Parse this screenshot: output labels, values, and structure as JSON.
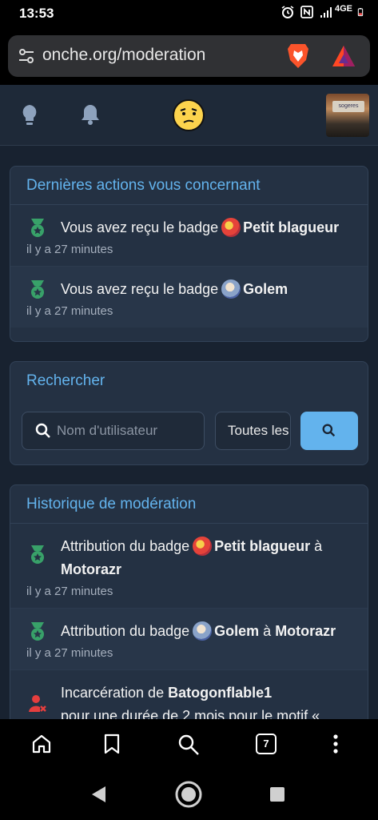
{
  "status": {
    "time": "13:53",
    "network": "4GE"
  },
  "browser": {
    "url": "onche.org/moderation"
  },
  "recent": {
    "title": "Dernières actions vous concernant",
    "items": [
      {
        "prefix": "Vous avez reçu le badge",
        "badge": "Petit blagueur",
        "time": "il y a 27 minutes"
      },
      {
        "prefix": "Vous avez reçu le badge",
        "badge": "Golem",
        "time": "il y a 27 minutes"
      }
    ]
  },
  "search": {
    "title": "Rechercher",
    "placeholder": "Nom d'utilisateur",
    "select_value": "Toutes les"
  },
  "history": {
    "title": "Historique de modération",
    "items": [
      {
        "prefix": "Attribution du badge",
        "badge": "Petit blagueur",
        "joiner": "à",
        "user": "Motorazr",
        "time": "il y a 27 minutes"
      },
      {
        "prefix": "Attribution du badge",
        "badge": "Golem",
        "joiner": "à",
        "user": "Motorazr",
        "time": "il y a 27 minutes"
      },
      {
        "prefix": "Incarcération de",
        "user": "Batogonflable1",
        "line2": "pour une durée de 2 mois pour le motif «"
      }
    ]
  },
  "tabs": {
    "count": "7"
  },
  "colors": {
    "accent": "#63b3ed",
    "medal": "#38a169",
    "danger": "#e53e3e",
    "card": "#243143",
    "page": "#182230"
  }
}
